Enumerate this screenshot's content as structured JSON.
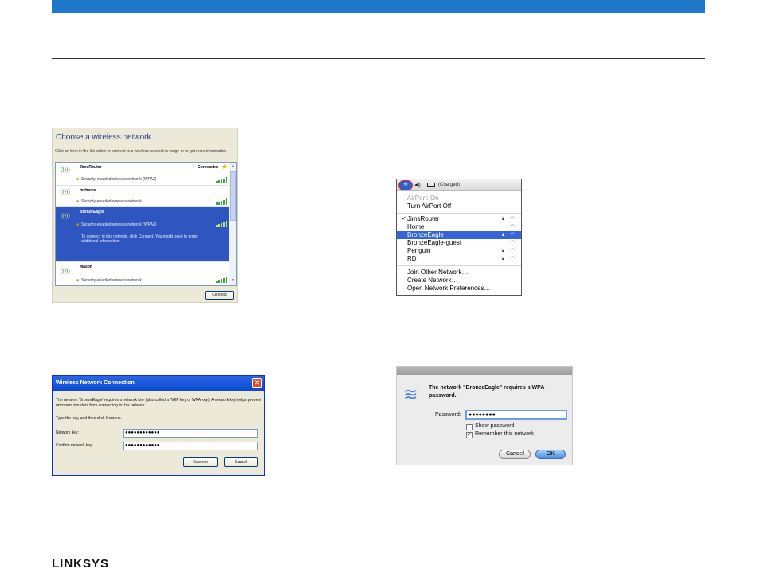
{
  "brand": {
    "logo": "LINKSYS",
    "top_bar_color": "#1f77c9"
  },
  "xp_choose": {
    "title": "Choose a wireless network",
    "description": "Click an item in the list below to connect to a wireless network in range or to get more information.",
    "networks": [
      {
        "name": "JimsRouter",
        "status": "Connected",
        "security": "Security-enabled wireless network (WPA2)"
      },
      {
        "name": "myhome",
        "status": "",
        "security": "Security-enabled wireless network"
      },
      {
        "name": "BronzeEagle",
        "status": "",
        "security": "Security-enabled wireless network (WPA2)",
        "hint": "To connect to this network, click Connect. You might need to enter additional information."
      },
      {
        "name": "Mason",
        "status": "",
        "security": "Security-enabled wireless network"
      }
    ],
    "connect_button": "Connect"
  },
  "xp_dialog": {
    "title": "Wireless Network Connection",
    "message": "The network 'BronzeEagle' requires a network key (also called a WEP key or WPA key). A network key helps prevent unknown intruders from connecting to this network.",
    "instruction": "Type the key, and then click Connect.",
    "network_key_label": "Network key:",
    "network_key_value": "●●●●●●●●●●●●",
    "confirm_key_label": "Confirm network key:",
    "confirm_key_value": "●●●●●●●●●●●●",
    "connect_button": "Connect",
    "cancel_button": "Cancel"
  },
  "mac_menu": {
    "battery_label": "(Charged)",
    "airport_status": "AirPort: On",
    "turn_off": "Turn AirPort Off",
    "networks": [
      {
        "name": "JimsRouter",
        "checked": true,
        "locked": true
      },
      {
        "name": "Home",
        "checked": false,
        "locked": false
      },
      {
        "name": "BronzeEagle",
        "checked": false,
        "locked": true
      },
      {
        "name": "BronzeEagle-guest",
        "checked": false,
        "locked": false
      },
      {
        "name": "Penguin",
        "checked": false,
        "locked": true
      },
      {
        "name": "RD",
        "checked": false,
        "locked": true
      }
    ],
    "join_other": "Join Other Network…",
    "create_network": "Create Network…",
    "open_prefs": "Open Network Preferences…",
    "highlight_color": "#3566d8"
  },
  "mac_dialog": {
    "heading": "The network \"BronzeEagle\" requires a WPA password.",
    "password_label": "Password:",
    "password_value": "●●●●●●●●",
    "show_password": "Show password",
    "remember": "Remember this network",
    "cancel_button": "Cancel",
    "ok_button": "OK"
  }
}
